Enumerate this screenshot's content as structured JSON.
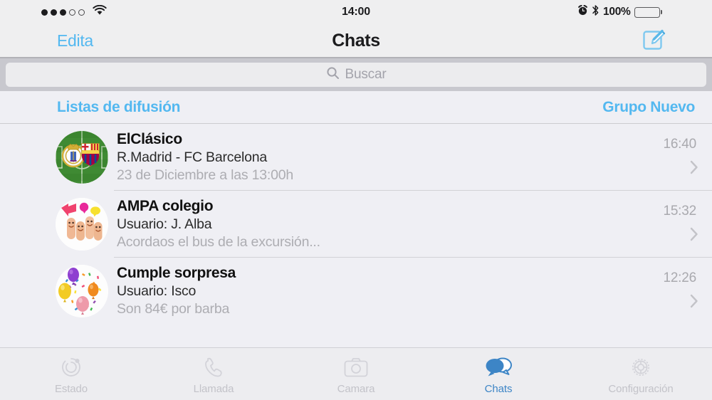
{
  "status_bar": {
    "signal_dots_filled": 3,
    "signal_dots_empty": 2,
    "wifi_icon": "wifi-icon",
    "time": "14:00",
    "alarm_icon": "alarm-clock-icon",
    "bluetooth_icon": "bluetooth-icon",
    "battery_percent": "100%",
    "battery_level": 100,
    "battery_color": "#3ac13a"
  },
  "nav_bar": {
    "edit_label": "Edita",
    "title": "Chats",
    "compose_icon": "compose-icon",
    "accent_color": "#53b8f0"
  },
  "search": {
    "placeholder": "Buscar",
    "icon": "search-icon"
  },
  "broadcast": {
    "lists_label": "Listas de difusión",
    "new_group_label": "Grupo Nuevo"
  },
  "chats": [
    {
      "avatar": "football-pitch-crests-avatar",
      "title": "ElClásico",
      "subtitle": "R.Madrid - FC Barcelona",
      "preview": "23 de Diciembre a las 13:00h",
      "time": "16:40",
      "chevron": "chevron-right-icon"
    },
    {
      "avatar": "smiling-fingers-avatar",
      "title": "AMPA colegio",
      "subtitle": "Usuario: J. Alba",
      "preview": "Acordaos el bus de la excursión...",
      "time": "15:32",
      "chevron": "chevron-right-icon"
    },
    {
      "avatar": "balloons-confetti-avatar",
      "title": "Cumple sorpresa",
      "subtitle": "Usuario: Isco",
      "preview": "Son 84€ por barba",
      "time": "12:26",
      "chevron": "chevron-right-icon"
    }
  ],
  "tab_bar": {
    "active_color": "#3d85c6",
    "inactive_color": "#c3c3c9",
    "items": [
      {
        "label": "Estado",
        "icon": "status-ring-icon",
        "active": false
      },
      {
        "label": "Llamada",
        "icon": "phone-icon",
        "active": false
      },
      {
        "label": "Camara",
        "icon": "camera-icon",
        "active": false
      },
      {
        "label": "Chats",
        "icon": "chat-bubbles-icon",
        "active": true
      },
      {
        "label": "Configuración",
        "icon": "gear-icon",
        "active": false
      }
    ]
  }
}
